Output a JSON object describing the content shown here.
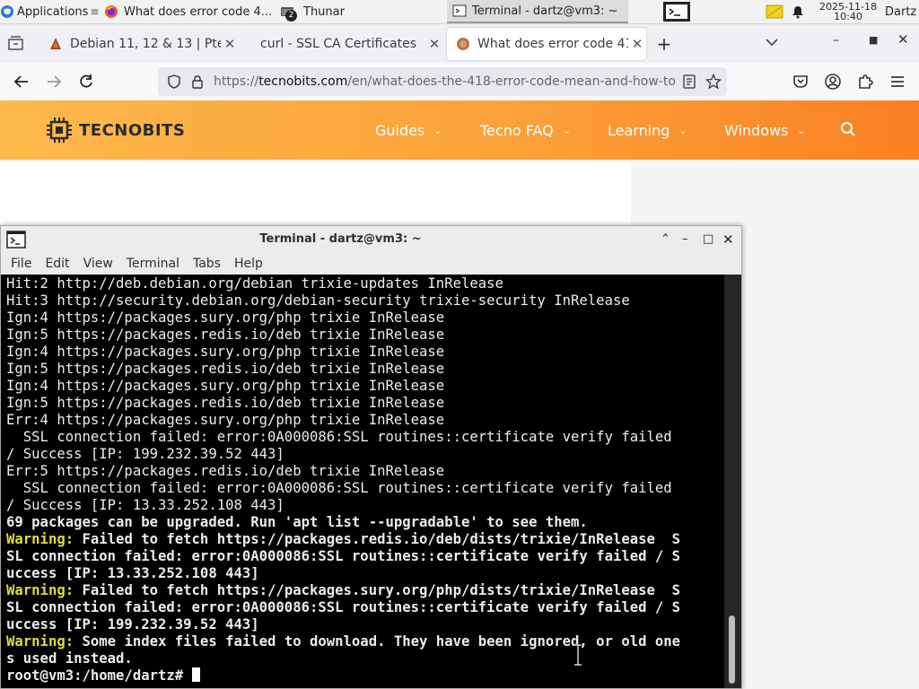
{
  "panel": {
    "applications_label": "Applications",
    "tasks": [
      {
        "label": "What does error code 4..."
      },
      {
        "label": "Thunar",
        "badge": "2"
      },
      {
        "label": "Terminal - dartz@vm3: ~"
      }
    ],
    "clock_date": "2025-11-18",
    "clock_time": "10:40",
    "user": "Dartz"
  },
  "firefox": {
    "tabs": [
      {
        "label": "Debian 11, 12 & 13 | Pte"
      },
      {
        "label": "curl - SSL CA Certificates"
      },
      {
        "label": "What does error code 41"
      }
    ],
    "url_prefix": "https://",
    "url_domain": "tecnobits.com",
    "url_path": "/en/what-does-the-418-error-code-mean-and-how-to"
  },
  "site": {
    "logo_text": "TECNOBITS",
    "nav": [
      "Guides",
      "Tecno FAQ",
      "Learning",
      "Windows"
    ]
  },
  "terminal": {
    "title": "Terminal - dartz@vm3: ~",
    "menu": [
      "File",
      "Edit",
      "View",
      "Terminal",
      "Tabs",
      "Help"
    ],
    "lines": [
      "Hit:2 http://deb.debian.org/debian trixie-updates InRelease",
      "Hit:3 http://security.debian.org/debian-security trixie-security InRelease",
      "Ign:4 https://packages.sury.org/php trixie InRelease",
      "Ign:5 https://packages.redis.io/deb trixie InRelease",
      "Ign:4 https://packages.sury.org/php trixie InRelease",
      "Ign:5 https://packages.redis.io/deb trixie InRelease",
      "Ign:4 https://packages.sury.org/php trixie InRelease",
      "Ign:5 https://packages.redis.io/deb trixie InRelease",
      "Err:4 https://packages.sury.org/php trixie InRelease",
      "  SSL connection failed: error:0A000086:SSL routines::certificate verify failed",
      "/ Success [IP: 199.232.39.52 443]",
      "Err:5 https://packages.redis.io/deb trixie InRelease",
      "  SSL connection failed: error:0A000086:SSL routines::certificate verify failed",
      "/ Success [IP: 13.33.252.108 443]",
      "69 packages can be upgraded. Run 'apt list --upgradable' to see them.",
      "Warning: Failed to fetch https://packages.redis.io/deb/dists/trixie/InRelease  S",
      "SL connection failed: error:0A000086:SSL routines::certificate verify failed / S",
      "uccess [IP: 13.33.252.108 443]",
      "Warning: Failed to fetch https://packages.sury.org/php/dists/trixie/InRelease  S",
      "SL connection failed: error:0A000086:SSL routines::certificate verify failed / S",
      "uccess [IP: 199.232.39.52 443]",
      "Warning: Some index files failed to download. They have been ignored, or old one",
      "s used instead.",
      "root@vm3:/home/dartz# "
    ],
    "warning_prefix": "Warning:",
    "colors": {
      "background": "#000000",
      "foreground": "#ececec",
      "warning": "#e0dc39"
    }
  },
  "colors": {
    "header_gradient_start": "#fdb94b",
    "header_gradient_end": "#fa8022",
    "panel_bg": "#f2f2f2"
  }
}
